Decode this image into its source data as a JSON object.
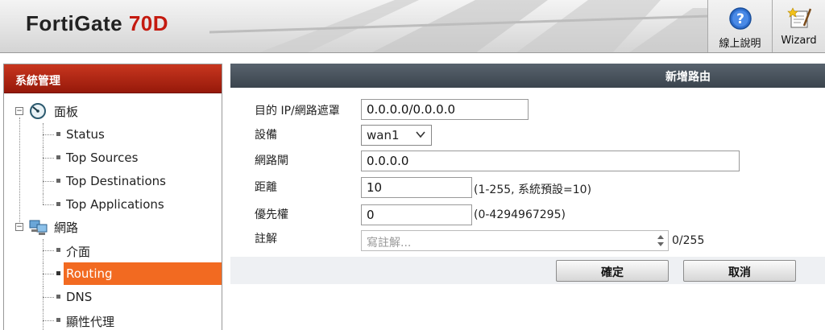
{
  "header": {
    "brand_name": "FortiGate",
    "brand_model": "70D",
    "help_label": "線上說明",
    "wizard_label": "Wizard"
  },
  "sidebar": {
    "title": "系統管理",
    "groups": [
      {
        "label": "面板",
        "icon": "dashboard-gauge-icon",
        "items": [
          "Status",
          "Top Sources",
          "Top Destinations",
          "Top Applications"
        ]
      },
      {
        "label": "網路",
        "icon": "network-computers-icon",
        "items": [
          "介面",
          "Routing",
          "DNS",
          "顯性代理"
        ]
      }
    ],
    "active_item": "Routing"
  },
  "form": {
    "title": "新增路由",
    "fields": {
      "dest": {
        "label": "目的 IP/網路遮罩",
        "value": "0.0.0.0/0.0.0.0"
      },
      "device": {
        "label": "設備",
        "value": "wan1"
      },
      "gateway": {
        "label": "網路閘",
        "value": "0.0.0.0"
      },
      "distance": {
        "label": "距離",
        "value": "10",
        "hint": "(1-255, 系統預設=10)"
      },
      "priority": {
        "label": "優先權",
        "value": "0",
        "hint": "(0-4294967295)"
      },
      "comment": {
        "label": "註解",
        "placeholder": "寫註解...",
        "counter": "0/255"
      }
    },
    "ok_label": "確定",
    "cancel_label": "取消"
  },
  "colors": {
    "brand_red": "#c41a0f",
    "sidebar_header": "#b22a15",
    "active_item": "#f26a21",
    "panel_header": "#4a545e"
  }
}
